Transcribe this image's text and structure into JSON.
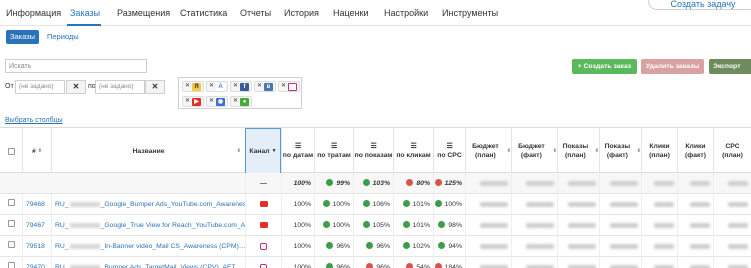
{
  "nav": {
    "tabs": [
      "Информация",
      "Заказы",
      "Размещения",
      "Статистика",
      "Отчеты",
      "История",
      "Наценки",
      "Настройки",
      "Инструменты"
    ],
    "active": "Заказы",
    "create_task": "Создать задачу"
  },
  "subtabs": {
    "orders": "Заказы",
    "periods": "Периоды"
  },
  "search": {
    "placeholder": "Искать"
  },
  "date_filter": {
    "from_label": "От",
    "to_label": "по",
    "from_value": "(не задано)",
    "to_value": "(не задано)",
    "clear": "✕"
  },
  "channels": {
    "chips": [
      {
        "icon": "yandex-icon",
        "color": "#f7c948",
        "glyph": "Я"
      },
      {
        "icon": "google-ads-icon",
        "color": "#4285f4",
        "glyph": "A"
      },
      {
        "icon": "facebook-icon",
        "color": "#3b5998",
        "glyph": "f"
      },
      {
        "icon": "vk-icon",
        "color": "#4a76a8",
        "glyph": "в"
      },
      {
        "icon": "instagram-icon",
        "color": "#c7306e",
        "glyph": "◎"
      },
      {
        "icon": "youtube-icon",
        "color": "#e52d27",
        "glyph": "▶"
      },
      {
        "icon": "mytarget-icon",
        "color": "#3e6ec9",
        "glyph": "◉"
      },
      {
        "icon": "other-icon",
        "color": "#49a93d",
        "glyph": "●"
      }
    ]
  },
  "actions": {
    "create": "+ Создать заказ",
    "delete": "Удалить заказы",
    "export": "Экспорт"
  },
  "choose_columns": "Выбрать столбцы",
  "table": {
    "headers": {
      "num": "#",
      "name": "Название",
      "channel": "Канал",
      "by_dates": "по датам",
      "by_spend": "по тратам",
      "by_impr": "по показам",
      "by_clicks": "по кликам",
      "cpc_idx": "по CPC",
      "budget_plan": "Бюджет (план)",
      "budget_fact": "Бюджет (факт)",
      "impr_plan": "Показы (план)",
      "impr_fact": "Показы (факт)",
      "clicks_plan": "Клики (план)",
      "clicks_fact": "Клики (факт)",
      "cpc_plan": "CPC (план)"
    },
    "summary": {
      "channel": "—",
      "by_dates": "100%",
      "by_spend": "99%",
      "by_impr": "103%",
      "by_clicks": "80%",
      "cpc": "125%",
      "by_spend_status": "ok",
      "by_impr_status": "ok",
      "by_clicks_status": "bad",
      "cpc_status": "bad"
    },
    "rows": [
      {
        "id": "79468",
        "name_prefix": "RU_",
        "name_suffix": "_Google_Bumper Ads_YouTube.com_Awareness (",
        "channel": "youtube",
        "dates": "100%",
        "spend": "100%",
        "spend_s": "ok",
        "impr": "106%",
        "impr_s": "ok",
        "clicks": "101%",
        "clicks_s": "ok",
        "cpc": "100%",
        "cpc_s": "ok"
      },
      {
        "id": "79467",
        "name_prefix": "RU_",
        "name_suffix": "_Google_True View for Reach_YouTube.com_Awa…",
        "channel": "youtube",
        "dates": "100%",
        "spend": "100%",
        "spend_s": "ok",
        "impr": "105%",
        "impr_s": "ok",
        "clicks": "101%",
        "clicks_s": "ok",
        "cpc": "98%",
        "cpc_s": "ok"
      },
      {
        "id": "79518",
        "name_prefix": "RU_",
        "name_suffix": "_In-Banner video_Mail CS_Awareness (CPM)…",
        "channel": "instagram",
        "dates": "100%",
        "spend": "96%",
        "spend_s": "ok",
        "impr": "96%",
        "impr_s": "ok",
        "clicks": "102%",
        "clicks_s": "ok",
        "cpc": "94%",
        "cpc_s": "ok"
      },
      {
        "id": "79470",
        "name_prefix": "RU_",
        "name_suffix": "_Bumper Ads_TargetMail_Views (CPV)_AFT…",
        "channel": "instagram",
        "dates": "100%",
        "spend": "96%",
        "spend_s": "ok",
        "impr": "96%",
        "impr_s": "bad",
        "clicks": "54%",
        "clicks_s": "bad",
        "cpc": "184%",
        "cpc_s": "bad"
      }
    ]
  }
}
